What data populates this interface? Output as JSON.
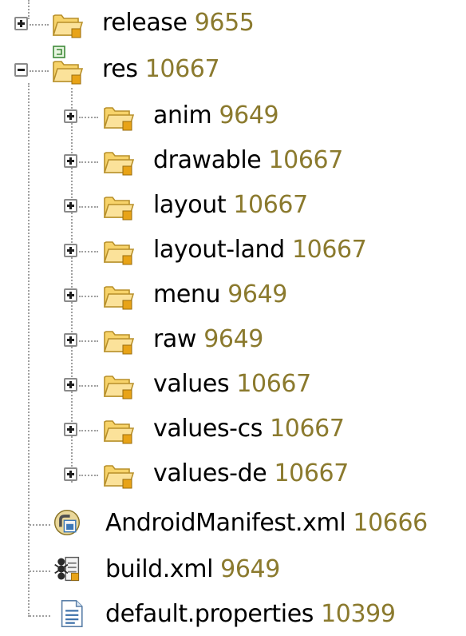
{
  "colors": {
    "revision_text": "#8b7a2e",
    "folder": "#f2c84b",
    "tree_lines": "#a0a0a0"
  },
  "tree": {
    "items": [
      {
        "name": "release",
        "revision": "9655",
        "icon": "folder-icon",
        "expander": "expand-plus-icon"
      },
      {
        "name": "res",
        "revision": "10667",
        "icon": "folder-modified-icon",
        "expander": "collapse-minus-icon"
      },
      {
        "name": "anim",
        "revision": "9649",
        "icon": "folder-icon",
        "expander": "expand-plus-icon"
      },
      {
        "name": "drawable",
        "revision": "10667",
        "icon": "folder-icon",
        "expander": "expand-plus-icon"
      },
      {
        "name": "layout",
        "revision": "10667",
        "icon": "folder-icon",
        "expander": "expand-plus-icon"
      },
      {
        "name": "layout-land",
        "revision": "10667",
        "icon": "folder-icon",
        "expander": "expand-plus-icon"
      },
      {
        "name": "menu",
        "revision": "9649",
        "icon": "folder-icon",
        "expander": "expand-plus-icon"
      },
      {
        "name": "raw",
        "revision": "9649",
        "icon": "folder-icon",
        "expander": "expand-plus-icon"
      },
      {
        "name": "values",
        "revision": "10667",
        "icon": "folder-icon",
        "expander": "expand-plus-icon"
      },
      {
        "name": "values-cs",
        "revision": "10667",
        "icon": "folder-icon",
        "expander": "expand-plus-icon"
      },
      {
        "name": "values-de",
        "revision": "10667",
        "icon": "folder-icon",
        "expander": "expand-plus-icon"
      },
      {
        "name": "AndroidManifest.xml",
        "revision": "10666",
        "icon": "android-manifest-icon"
      },
      {
        "name": "build.xml",
        "revision": "9649",
        "icon": "ant-build-file-icon"
      },
      {
        "name": "default.properties",
        "revision": "10399",
        "icon": "properties-file-icon"
      }
    ]
  }
}
